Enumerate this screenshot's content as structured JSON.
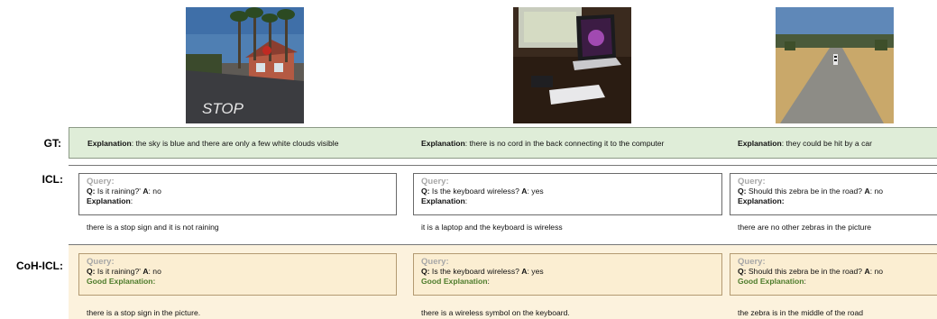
{
  "row_labels": {
    "gt": "GT:",
    "icl": "ICL:",
    "coh_icl": "CoH-ICL:"
  },
  "images": [
    {
      "name": "stop-sign-street-photo",
      "painted_text": "STOP"
    },
    {
      "name": "desk-laptop-keyboard-photo"
    },
    {
      "name": "zebra-on-road-photo"
    }
  ],
  "gt": [
    {
      "label": "Explanation",
      "text": ":  the sky is blue and there are only a few white clouds visible"
    },
    {
      "label": "Explanation",
      "text": ": there is no cord in the back connecting it to the computer"
    },
    {
      "label": "Explanation",
      "text": ": they could be hit by a car"
    }
  ],
  "icl": [
    {
      "query_label": "Query:",
      "q_label": "Q:",
      "question": " Is it raining?'",
      "a_label": "A",
      "answer": ": no",
      "expl_label": "Explanation",
      "expl_tail": ":",
      "answer_text": "there is a stop sign and it is not raining"
    },
    {
      "query_label": "Query:",
      "q_label": "Q:",
      "question": " Is the keyboard wireless?",
      "a_label": "A",
      "answer": ": yes",
      "expl_label": "Explanation",
      "expl_tail": ":",
      "answer_text": "it is a laptop and the keyboard is wireless"
    },
    {
      "query_label": "Query:",
      "q_label": "Q:",
      "question": " Should this zebra be in the road?",
      "a_label": "A",
      "answer": ": no",
      "expl_label": "Explanation:",
      "expl_tail": "",
      "answer_text": "there are no other zebras in the picture"
    }
  ],
  "coh_icl": [
    {
      "query_label": "Query:",
      "q_label": "Q:",
      "question": " Is it raining?'",
      "a_label": "A",
      "answer": ": no",
      "good_label": "Good Explanation:",
      "good_tail": "",
      "answer_text": "there is a stop sign in the picture."
    },
    {
      "query_label": "Query:",
      "q_label": "Q:",
      "question": " Is the keyboard wireless?",
      "a_label": "A",
      "answer": ": yes",
      "good_label": "Good Explanation",
      "good_tail": ":",
      "answer_text": "there is a wireless symbol on the keyboard."
    },
    {
      "query_label": "Query:",
      "q_label": "Q:",
      "question": " Should this zebra be in the road?",
      "a_label": "A",
      "answer": ": no",
      "good_label": "Good Explanation",
      "good_tail": ":",
      "answer_text": "the zebra is in the middle of the road"
    }
  ],
  "colors": {
    "gt_band": "#dfedd8",
    "coh_band": "#fcf2dd",
    "good_text": "#4d7c2b",
    "query_label": "#a7a7a7"
  }
}
